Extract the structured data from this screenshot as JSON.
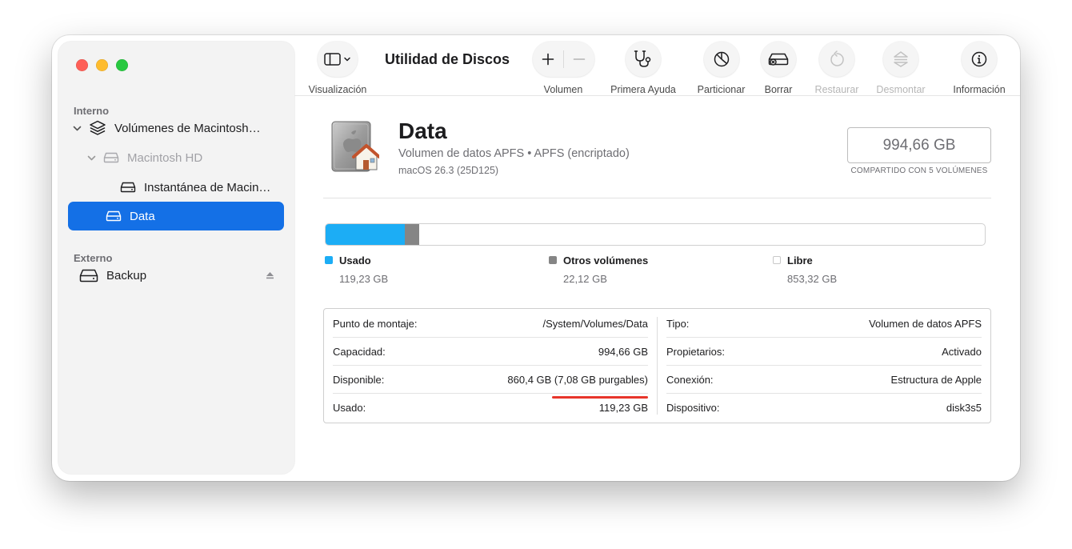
{
  "window": {
    "title": "Utilidad de Discos"
  },
  "toolbar": {
    "view_label": "Visualización",
    "volume_label": "Volumen",
    "first_aid_label": "Primera Ayuda",
    "partition_label": "Particionar",
    "erase_label": "Borrar",
    "restore_label": "Restaurar",
    "unmount_label": "Desmontar",
    "info_label": "Información"
  },
  "sidebar": {
    "internal_header": "Interno",
    "external_header": "Externo",
    "items": [
      {
        "label": "Volúmenes de Macintosh…",
        "icon": "layers-icon"
      },
      {
        "label": "Macintosh HD",
        "icon": "drive-icon"
      },
      {
        "label": "Instantánea de Macin…",
        "icon": "drive-icon"
      },
      {
        "label": "Data",
        "icon": "drive-icon",
        "selected": true
      },
      {
        "label": "Backup",
        "icon": "drive-icon"
      }
    ]
  },
  "volume": {
    "name": "Data",
    "description": "Volumen de datos APFS • APFS (encriptado)",
    "os": "macOS 26.3 (25D125)",
    "capacity": "994,66 GB",
    "shared_note": "COMPARTIDO CON 5 VOLÚMENES"
  },
  "usage": {
    "used_fraction": 0.1199,
    "other_fraction": 0.0222,
    "legend": [
      {
        "name": "Usado",
        "value": "119,23 GB",
        "color": "#1cadf5"
      },
      {
        "name": "Otros volúmenes",
        "value": "22,12 GB",
        "color": "#858585"
      },
      {
        "name": "Libre",
        "value": "853,32 GB",
        "color": "#ffffff"
      }
    ]
  },
  "info": {
    "left": [
      {
        "key": "Punto de montaje:",
        "value": "/System/Volumes/Data"
      },
      {
        "key": "Capacidad:",
        "value": "994,66 GB"
      },
      {
        "key": "Disponible:",
        "value": "860,4 GB (7,08 GB purgables)"
      },
      {
        "key": "Usado:",
        "value": "119,23 GB"
      }
    ],
    "right": [
      {
        "key": "Tipo:",
        "value": "Volumen de datos APFS"
      },
      {
        "key": "Propietarios:",
        "value": "Activado"
      },
      {
        "key": "Conexión:",
        "value": "Estructura de Apple"
      },
      {
        "key": "Dispositivo:",
        "value": "disk3s5"
      }
    ]
  },
  "colors": {
    "accent": "#1470e6",
    "used": "#1cadf5",
    "other": "#858585",
    "highlight": "#e8352b"
  }
}
